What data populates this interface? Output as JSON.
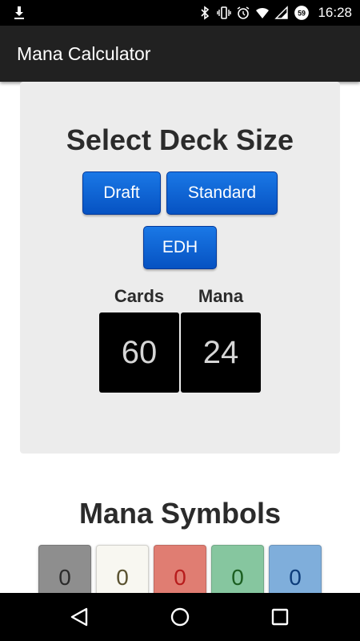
{
  "status_bar": {
    "time": "16:28",
    "notification_count": "59",
    "icons": [
      "download-icon",
      "bluetooth-icon",
      "vibrate-icon",
      "alarm-icon",
      "wifi-icon",
      "signal-icon",
      "data-saver-icon"
    ]
  },
  "app_bar": {
    "title": "Mana Calculator"
  },
  "deck": {
    "title": "Select Deck Size",
    "buttons": {
      "draft": "Draft",
      "standard": "Standard",
      "edh": "EDH"
    },
    "cards_label": "Cards",
    "mana_label": "Mana",
    "cards_value": "60",
    "mana_value": "24"
  },
  "mana_symbols": {
    "title": "Mana Symbols",
    "items": [
      {
        "value": "0",
        "bg": "#8e8e8e",
        "fg": "#2b2b2b"
      },
      {
        "value": "0",
        "bg": "#f8f7f1",
        "fg": "#5a5230"
      },
      {
        "value": "0",
        "bg": "#e07d72",
        "fg": "#b71c1c"
      },
      {
        "value": "0",
        "bg": "#86c69f",
        "fg": "#1b5e20"
      },
      {
        "value": "0",
        "bg": "#7faedb",
        "fg": "#0d3c7a"
      }
    ]
  },
  "nav": {
    "icons": [
      "back-icon",
      "home-icon",
      "recents-icon"
    ]
  }
}
